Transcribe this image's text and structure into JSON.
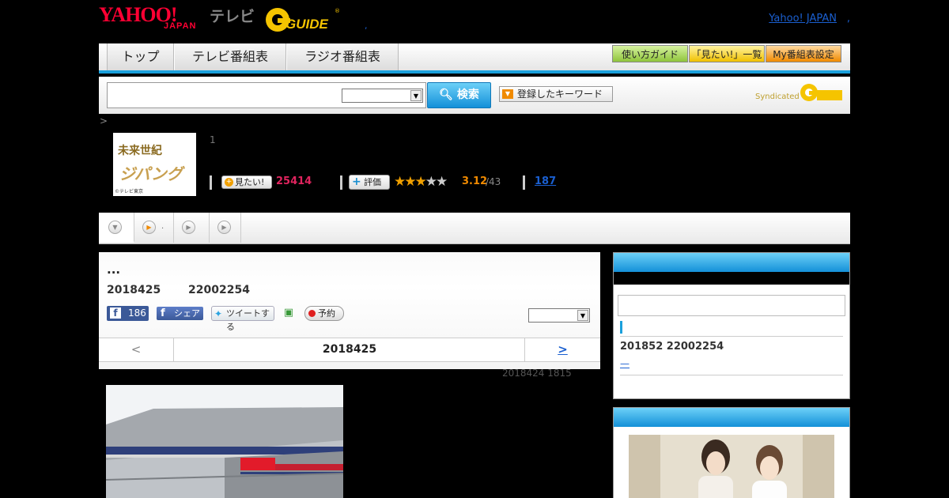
{
  "header": {
    "logo_yahoo": "YAHOO!",
    "logo_japan": "JAPAN",
    "logo_tv": "テレビ",
    "logo_gguide": "GUIDE",
    "separator": ",",
    "yahoo_link": "Yahoo! JAPAN",
    "trailing": ","
  },
  "nav": {
    "tabs": [
      "トップ",
      "テレビ番組表",
      "ラジオ番組表"
    ],
    "buttons": [
      "使い方ガイド",
      "「見たい!」一覧",
      "My番組表設定"
    ]
  },
  "search": {
    "value": "",
    "select_value": "",
    "search_button": "検索",
    "keyword_button": "登録したキーワード",
    "syndicated": "Syndicated"
  },
  "breadcrumb": ">",
  "program": {
    "thumb_title": "未来世紀",
    "thumb_subtitle": "ジパング",
    "thumb_copyright": "©テレビ東京",
    "episode_num": "1",
    "mitai_label": "見たい!",
    "mitai_count": "25414",
    "hyoka_label": "評価",
    "rating": 3.12,
    "rating_text": "3.12",
    "rating_votes": "/43",
    "stars_on": "★★★",
    "stars_off": "★★",
    "review_count": "187"
  },
  "tabstrip": {
    "item2_dot": "."
  },
  "article": {
    "title": "...",
    "date": "2018425",
    "time": "22002254",
    "fb_count": "186",
    "fb_f": "f",
    "share_label": "シェア",
    "tweet_label": "ツイートする",
    "yoyaku_label": "予約",
    "select_value": "",
    "pager_prev": "<",
    "pager_date": "2018425",
    "pager_next": ">",
    "updated": "2018424  1815"
  },
  "sidebar": {
    "box1_input": "",
    "box1_date": "201852  22002254",
    "box1_link": "—"
  },
  "colors": {
    "accent_blue": "#1aa0dc",
    "yahoo_red": "#ff0033",
    "gguide_yellow": "#f5c400",
    "link_blue": "#1a5fd0",
    "mitai_pink": "#e0245e",
    "star_orange": "#f0a000"
  },
  "icons": {
    "search": "magnifier-icon",
    "keyword": "triangle-down-icon",
    "mitai": "plus-circle-icon",
    "hyoka": "plus-icon",
    "tweet": "bird-icon",
    "mypage": "mypage-icon",
    "yoyaku": "record-dot-icon",
    "tab": "play-circle-icon"
  }
}
